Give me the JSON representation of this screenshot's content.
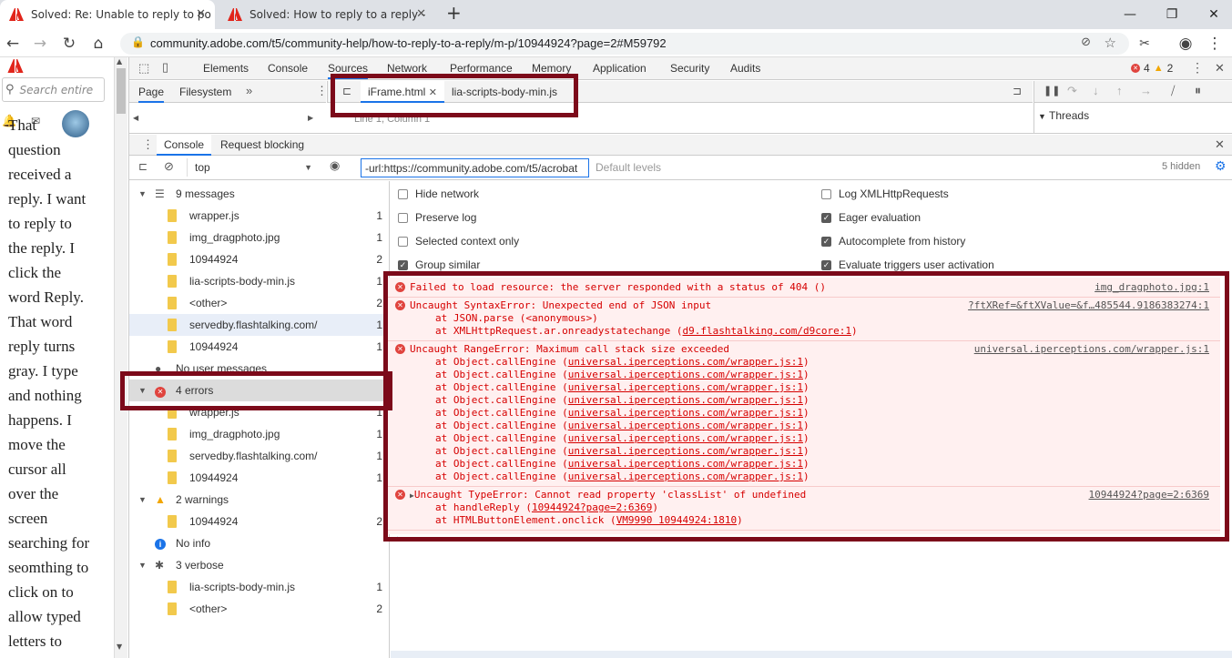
{
  "browser": {
    "tabs": [
      {
        "title": "Solved: Re: Unable to reply to po",
        "active": true
      },
      {
        "title": "Solved: How to reply to a reply -",
        "active": false
      }
    ],
    "new_tab": "+",
    "url": "community.adobe.com/t5/community-help/how-to-reply-to-a-reply/m-p/10944924?page=2#M59792"
  },
  "page": {
    "search_placeholder": "Search entire",
    "post_words": [
      "That",
      "question",
      "received a",
      "reply. I want",
      "to reply to",
      "the reply. I",
      "click the",
      "word Reply.",
      "That word",
      "reply turns",
      "gray. I type",
      "and nothing",
      "happens. I",
      "move the",
      "cursor all",
      "over the",
      "screen",
      "searching for",
      "seomthing to",
      "click on to",
      "allow typed",
      "letters to"
    ]
  },
  "devtools": {
    "tabs": [
      "Elements",
      "Console",
      "Sources",
      "Network",
      "Performance",
      "Memory",
      "Application",
      "Security",
      "Audits"
    ],
    "selected_tab": "Sources",
    "error_count": "4",
    "warning_count": "2",
    "navigator_tabs": [
      "Page",
      "Filesystem"
    ],
    "editor_tabs": [
      "iFrame.html",
      "lia-scripts-body-min.js"
    ],
    "cursor_pos": "Line 1, Column 1",
    "threads_label": "Threads",
    "drawer_tabs": [
      "Console",
      "Request blocking"
    ],
    "context": "top",
    "filter_value": "-url:https://community.adobe.com/t5/acrobat",
    "levels": "Default levels",
    "hidden": "5 hidden"
  },
  "sidebar": {
    "groups": [
      {
        "label": "9 messages",
        "type": "messages",
        "items": [
          {
            "name": "wrapper.js",
            "count": "1"
          },
          {
            "name": "img_dragphoto.jpg",
            "count": "1"
          },
          {
            "name": "10944924",
            "count": "2"
          },
          {
            "name": "lia-scripts-body-min.js",
            "count": "1"
          },
          {
            "name": "<other>",
            "count": "2"
          },
          {
            "name": "servedby.flashtalking.com/",
            "count": "1"
          },
          {
            "name": "10944924",
            "count": "1"
          }
        ]
      },
      {
        "label": "No user messages",
        "type": "user"
      },
      {
        "label": "4 errors",
        "type": "errors",
        "items": [
          {
            "name": "wrapper.js",
            "count": "1"
          },
          {
            "name": "img_dragphoto.jpg",
            "count": "1"
          },
          {
            "name": "servedby.flashtalking.com/",
            "count": "1"
          },
          {
            "name": "10944924",
            "count": "1"
          }
        ]
      },
      {
        "label": "2 warnings",
        "type": "warnings",
        "items": [
          {
            "name": "10944924",
            "count": "2"
          }
        ]
      },
      {
        "label": "No info",
        "type": "info"
      },
      {
        "label": "3 verbose",
        "type": "verbose",
        "items": [
          {
            "name": "lia-scripts-body-min.js",
            "count": "1"
          },
          {
            "name": "<other>",
            "count": "2"
          }
        ]
      }
    ]
  },
  "settings": {
    "left": [
      {
        "label": "Hide network",
        "checked": false
      },
      {
        "label": "Preserve log",
        "checked": false
      },
      {
        "label": "Selected context only",
        "checked": false
      },
      {
        "label": "Group similar",
        "checked": true
      }
    ],
    "right": [
      {
        "label": "Log XMLHttpRequests",
        "checked": false
      },
      {
        "label": "Eager evaluation",
        "checked": true
      },
      {
        "label": "Autocomplete from history",
        "checked": true
      },
      {
        "label": "Evaluate triggers user activation",
        "checked": true
      }
    ]
  },
  "errors": [
    {
      "message": "Failed to load resource: the server responded with a status of 404 ()",
      "source": "img_dragphoto.jpg:1",
      "stack": []
    },
    {
      "message": "Uncaught SyntaxError: Unexpected end of JSON input",
      "source": "?ftXRef=&ftXValue=&f…485544.9186383274:1",
      "stack": [
        {
          "fn": "at JSON.parse (<anonymous>)",
          "link": ""
        },
        {
          "fn": "at XMLHttpRequest.ar.onreadystatechange",
          "link": "d9.flashtalking.com/d9core:1"
        }
      ]
    },
    {
      "message": "Uncaught RangeError: Maximum call stack size exceeded",
      "source": "universal.iperceptions.com/wrapper.js:1",
      "stack": [
        {
          "fn": "at Object.callEngine",
          "link": "universal.iperceptions.com/wrapper.js:1"
        },
        {
          "fn": "at Object.callEngine",
          "link": "universal.iperceptions.com/wrapper.js:1"
        },
        {
          "fn": "at Object.callEngine",
          "link": "universal.iperceptions.com/wrapper.js:1"
        },
        {
          "fn": "at Object.callEngine",
          "link": "universal.iperceptions.com/wrapper.js:1"
        },
        {
          "fn": "at Object.callEngine",
          "link": "universal.iperceptions.com/wrapper.js:1"
        },
        {
          "fn": "at Object.callEngine",
          "link": "universal.iperceptions.com/wrapper.js:1"
        },
        {
          "fn": "at Object.callEngine",
          "link": "universal.iperceptions.com/wrapper.js:1"
        },
        {
          "fn": "at Object.callEngine",
          "link": "universal.iperceptions.com/wrapper.js:1"
        },
        {
          "fn": "at Object.callEngine",
          "link": "universal.iperceptions.com/wrapper.js:1"
        },
        {
          "fn": "at Object.callEngine",
          "link": "universal.iperceptions.com/wrapper.js:1"
        }
      ]
    },
    {
      "message": "Uncaught TypeError: Cannot read property 'classList' of undefined",
      "source": "10944924?page=2:6369",
      "stack": [
        {
          "fn": "at handleReply",
          "link": "10944924?page=2:6369"
        },
        {
          "fn": "at HTMLButtonElement.onclick",
          "link": "VM9990 10944924:1810"
        }
      ]
    }
  ],
  "colors": {
    "error_bg": "#fff0f0",
    "error_text": "#d60000",
    "highlight": "#7c0a1a",
    "adobe": "#e1251b"
  }
}
